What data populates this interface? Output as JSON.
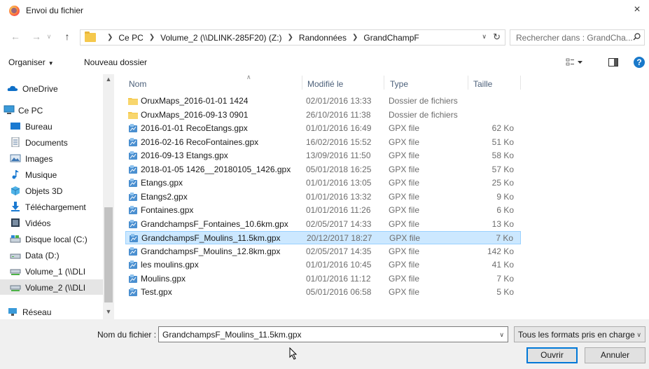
{
  "window": {
    "title": "Envoi du fichier",
    "close_label": "×"
  },
  "address": {
    "crumbs": [
      "Ce PC",
      "Volume_2 (\\\\DLINK-285F20) (Z:)",
      "Randonnées",
      "GrandChampF"
    ],
    "search_placeholder": "Rechercher dans : GrandCha..."
  },
  "toolbar": {
    "organize": "Organiser",
    "new_folder": "Nouveau dossier"
  },
  "sidebar": {
    "items": [
      {
        "label": "OneDrive",
        "icon": "cloud-icon"
      },
      {
        "label": "Ce PC",
        "icon": "computer-icon"
      },
      {
        "label": "Bureau",
        "icon": "desktop-icon"
      },
      {
        "label": "Documents",
        "icon": "documents-icon"
      },
      {
        "label": "Images",
        "icon": "images-icon"
      },
      {
        "label": "Musique",
        "icon": "music-icon"
      },
      {
        "label": "Objets 3D",
        "icon": "objects3d-icon"
      },
      {
        "label": "Téléchargement",
        "icon": "download-icon"
      },
      {
        "label": "Vidéos",
        "icon": "video-icon"
      },
      {
        "label": "Disque local (C:)",
        "icon": "drive-icon"
      },
      {
        "label": "Data (D:)",
        "icon": "drive-icon"
      },
      {
        "label": "Volume_1 (\\\\DLI",
        "icon": "network-drive-icon"
      },
      {
        "label": "Volume_2 (\\\\DLI",
        "icon": "network-drive-icon"
      },
      {
        "label": "Réseau",
        "icon": "network-icon"
      }
    ]
  },
  "columns": {
    "name": "Nom",
    "modified": "Modifié le",
    "type": "Type",
    "size": "Taille"
  },
  "files": [
    {
      "name": "OruxMaps_2016-01-01 1424",
      "date": "02/01/2016 13:33",
      "type": "Dossier de fichiers",
      "size": "",
      "kind": "folder"
    },
    {
      "name": "OruxMaps_2016-09-13 0901",
      "date": "26/10/2016 11:38",
      "type": "Dossier de fichiers",
      "size": "",
      "kind": "folder"
    },
    {
      "name": "2016-01-01 RecoEtangs.gpx",
      "date": "01/01/2016 16:49",
      "type": "GPX file",
      "size": "62 Ko",
      "kind": "gpx"
    },
    {
      "name": "2016-02-16 RecoFontaines.gpx",
      "date": "16/02/2016 15:52",
      "type": "GPX file",
      "size": "51 Ko",
      "kind": "gpx"
    },
    {
      "name": "2016-09-13 Etangs.gpx",
      "date": "13/09/2016 11:50",
      "type": "GPX file",
      "size": "58 Ko",
      "kind": "gpx"
    },
    {
      "name": "2018-01-05 1426__20180105_1426.gpx",
      "date": "05/01/2018 16:25",
      "type": "GPX file",
      "size": "57 Ko",
      "kind": "gpx"
    },
    {
      "name": "Etangs.gpx",
      "date": "01/01/2016 13:05",
      "type": "GPX file",
      "size": "25 Ko",
      "kind": "gpx"
    },
    {
      "name": "Etangs2.gpx",
      "date": "01/01/2016 13:32",
      "type": "GPX file",
      "size": "9 Ko",
      "kind": "gpx"
    },
    {
      "name": "Fontaines.gpx",
      "date": "01/01/2016 11:26",
      "type": "GPX file",
      "size": "6 Ko",
      "kind": "gpx"
    },
    {
      "name": "GrandchampsF_Fontaines_10.6km.gpx",
      "date": "02/05/2017 14:33",
      "type": "GPX file",
      "size": "13 Ko",
      "kind": "gpx"
    },
    {
      "name": "GrandchampsF_Moulins_11.5km.gpx",
      "date": "20/12/2017 18:27",
      "type": "GPX file",
      "size": "7 Ko",
      "kind": "gpx",
      "selected": true
    },
    {
      "name": "GrandchampsF_Moulins_12.8km.gpx",
      "date": "02/05/2017 14:35",
      "type": "GPX file",
      "size": "142 Ko",
      "kind": "gpx"
    },
    {
      "name": "les moulins.gpx",
      "date": "01/01/2016 10:45",
      "type": "GPX file",
      "size": "41 Ko",
      "kind": "gpx"
    },
    {
      "name": "Moulins.gpx",
      "date": "01/01/2016 11:12",
      "type": "GPX file",
      "size": "7 Ko",
      "kind": "gpx"
    },
    {
      "name": "Test.gpx",
      "date": "05/01/2016 06:58",
      "type": "GPX file",
      "size": "5 Ko",
      "kind": "gpx"
    }
  ],
  "footer": {
    "filename_label": "Nom du fichier :",
    "filename_value": "GrandchampsF_Moulins_11.5km.gpx",
    "filter_value": "Tous les formats pris en charge",
    "open_label": "Ouvrir",
    "cancel_label": "Annuler"
  },
  "colors": {
    "accent": "#0078d7",
    "selection": "#cce8ff",
    "folder": "#f5c84c"
  }
}
